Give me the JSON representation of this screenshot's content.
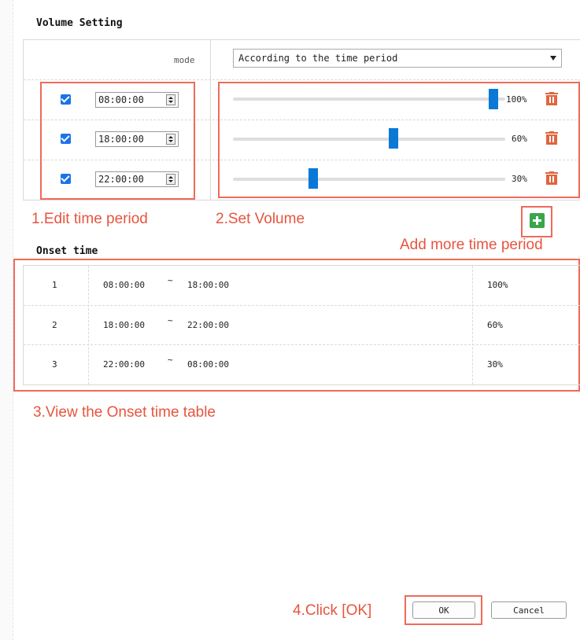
{
  "window": {
    "title": "Volume Setting"
  },
  "mode": {
    "label": "mode",
    "selected": "According to the time period"
  },
  "periods": [
    {
      "enabled": true,
      "time": "08:00:00",
      "volume_pct": 100,
      "volume_label": "100%"
    },
    {
      "enabled": true,
      "time": "18:00:00",
      "volume_pct": 60,
      "volume_label": "60%"
    },
    {
      "enabled": true,
      "time": "22:00:00",
      "volume_pct": 30,
      "volume_label": "30%"
    }
  ],
  "annotations": {
    "edit_time": "1.Edit time period",
    "set_volume": "2.Set Volume",
    "add_more": "Add more time period",
    "view_table": "3.View the Onset time table",
    "click_ok": "4.Click [OK]"
  },
  "onset": {
    "title": "Onset time",
    "rows": [
      {
        "index": "1",
        "start": "08:00:00",
        "sep": "~",
        "end": "18:00:00",
        "volume": "100%"
      },
      {
        "index": "2",
        "start": "18:00:00",
        "sep": "~",
        "end": "22:00:00",
        "volume": "60%"
      },
      {
        "index": "3",
        "start": "22:00:00",
        "sep": "~",
        "end": "08:00:00",
        "volume": "30%"
      }
    ]
  },
  "buttons": {
    "ok": "OK",
    "cancel": "Cancel"
  },
  "colors": {
    "accent": "#0a78d7",
    "annotation": "#e6553f",
    "add": "#3ba54a",
    "trash": "#e0653f"
  },
  "icons": {
    "trash": "trash-icon",
    "add": "plus-icon",
    "dropdown": "chevron-down-icon"
  }
}
